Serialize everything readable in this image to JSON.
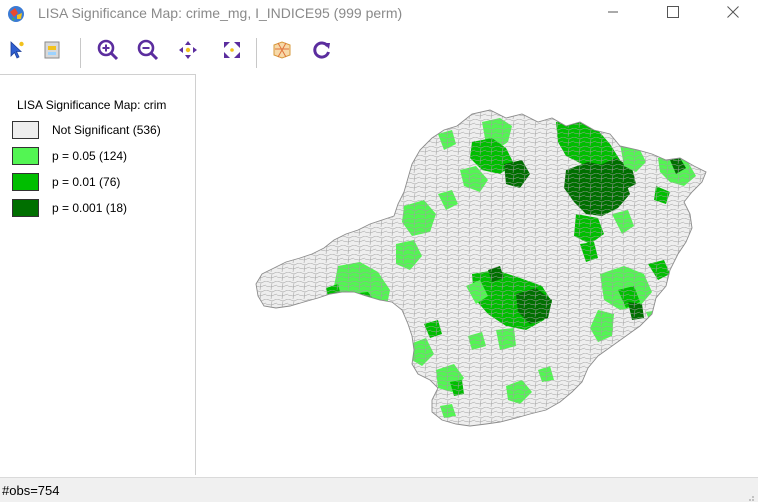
{
  "window": {
    "title": "LISA Significance Map: crime_mg, I_INDICE95 (999 perm)",
    "controls": [
      "minimize-icon",
      "maximize-icon",
      "close-icon"
    ]
  },
  "toolbar": {
    "icons": [
      "select-pointer-icon",
      "selection-options-icon",
      "zoom-in-icon",
      "zoom-out-icon",
      "pan-icon",
      "fit-extent-icon",
      "map-layer-icon",
      "refresh-icon"
    ]
  },
  "legend": {
    "title": "LISA Significance Map: crim",
    "items": [
      {
        "label": "Not Significant (536)",
        "color": "#eeeeee"
      },
      {
        "label": "p = 0.05 (124)",
        "color": "#53f553"
      },
      {
        "label": "p = 0.01 (76)",
        "color": "#00be00"
      },
      {
        "label": "p = 0.001 (18)",
        "color": "#006f00"
      }
    ]
  },
  "status": {
    "text": "#obs=754"
  },
  "colors": {
    "not_significant": "#eeeeee",
    "p05": "#53f553",
    "p01": "#00be00",
    "p001": "#006f00",
    "boundary": "#9a9a9a"
  }
}
